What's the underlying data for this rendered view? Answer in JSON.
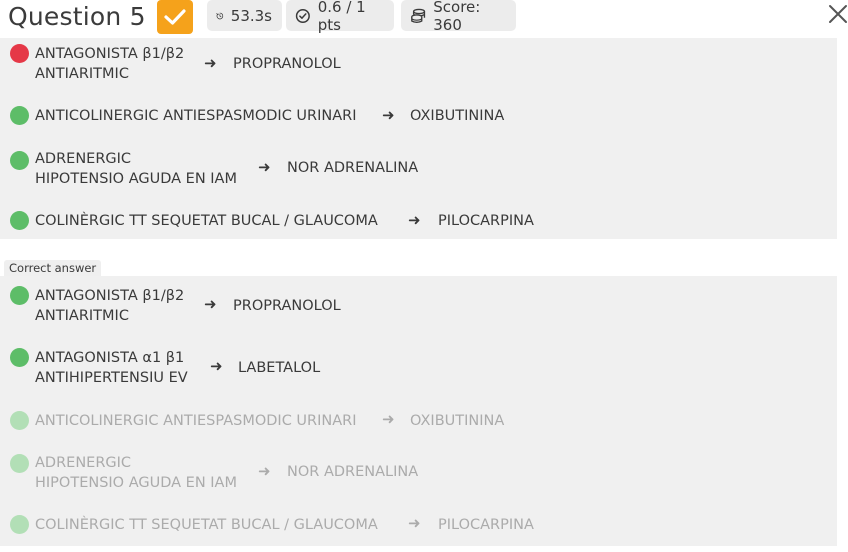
{
  "header": {
    "title": "Question 5",
    "time": "53.3s",
    "points": "0.6 / 1 pts",
    "score": "Score: 360"
  },
  "user_answer": {
    "rows": [
      {
        "status": "incorrect",
        "premise_line1": "ANTAGONISTA β1/β2",
        "premise_line2": "ANTIARITMIC",
        "answer": "PROPRANOLOL"
      },
      {
        "status": "correct",
        "premise_line1": "ANTICOLINERGIC ANTIESPASMODIC URINARI",
        "premise_line2": "",
        "answer": "OXIBUTININA"
      },
      {
        "status": "correct",
        "premise_line1": "ADRENERGIC",
        "premise_line2": "HIPOTENSIO AGUDA EN IAM",
        "answer": "NOR ADRENALINA"
      },
      {
        "status": "correct",
        "premise_line1": "COLINÈRGIC TT SEQUETAT BUCAL / GLAUCOMA",
        "premise_line2": "",
        "answer": "PILOCARPINA"
      }
    ]
  },
  "correct_answer": {
    "label": "Correct answer",
    "rows": [
      {
        "status": "correct",
        "premise_line1": "ANTAGONISTA β1/β2",
        "premise_line2": "ANTIARITMIC",
        "answer": "PROPRANOLOL"
      },
      {
        "status": "correct",
        "premise_line1": "ANTAGONISTA α1 β1",
        "premise_line2": "ANTIHIPERTENSIU EV",
        "answer": "LABETALOL"
      },
      {
        "status": "faded",
        "premise_line1": "ANTICOLINERGIC ANTIESPASMODIC URINARI",
        "premise_line2": "",
        "answer": "OXIBUTININA"
      },
      {
        "status": "faded",
        "premise_line1": "ADRENERGIC",
        "premise_line2": "HIPOTENSIO AGUDA EN IAM",
        "answer": "NOR ADRENALINA"
      },
      {
        "status": "faded",
        "premise_line1": "COLINÈRGIC TT SEQUETAT BUCAL / GLAUCOMA",
        "premise_line2": "",
        "answer": "PILOCARPINA"
      }
    ]
  },
  "arrow_glyph": "➜",
  "icons": {
    "status_check": "checkmark-icon",
    "time": "stopwatch-icon",
    "points": "circle-check-icon",
    "score": "coins-icon",
    "close": "close-icon"
  },
  "colors": {
    "accent": "#f5a21b",
    "incorrect": "#e53847",
    "correct": "#5dbd68",
    "faded": "#b2dfb6"
  }
}
